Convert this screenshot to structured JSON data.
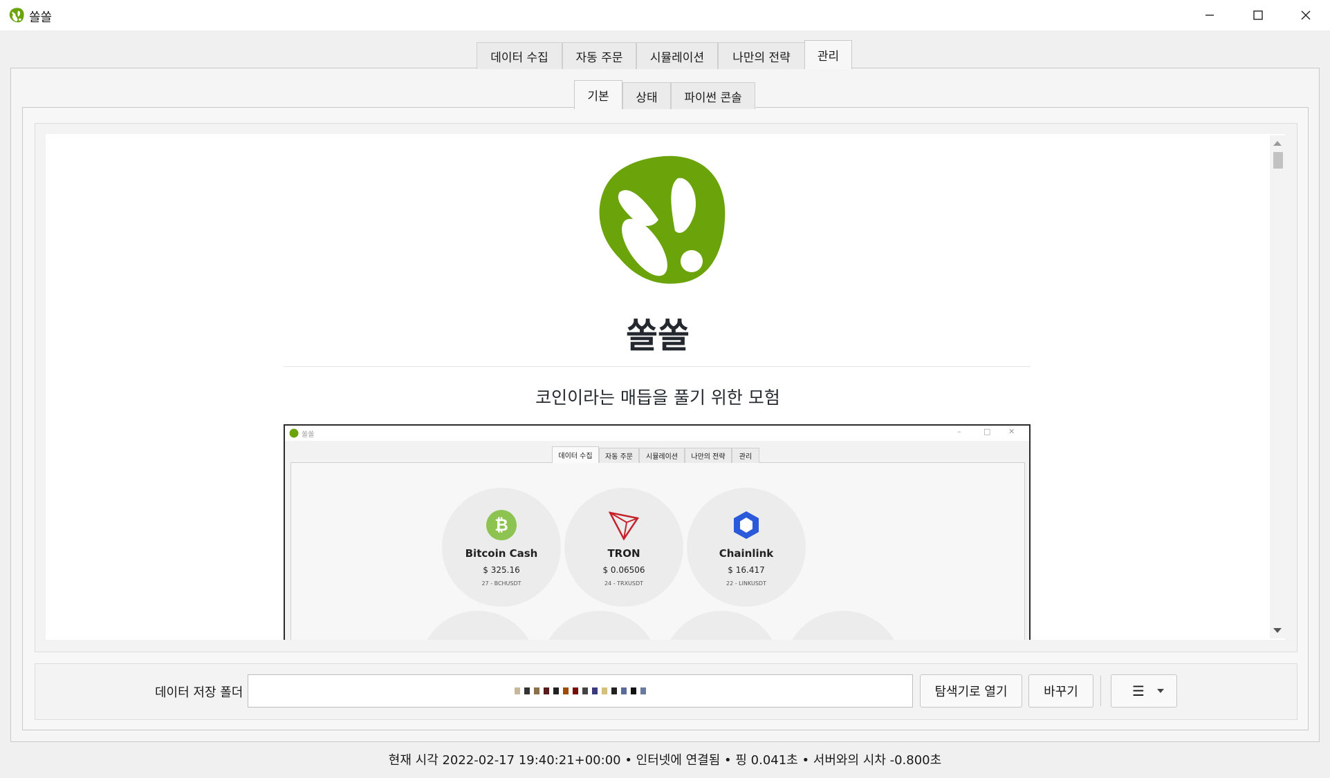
{
  "window": {
    "title": "쏠쏠"
  },
  "top_tabs": [
    {
      "label": "데이터 수집"
    },
    {
      "label": "자동 주문"
    },
    {
      "label": "시뮬레이션"
    },
    {
      "label": "나만의 전략"
    },
    {
      "label": "관리",
      "active": true
    }
  ],
  "sub_tabs": [
    {
      "label": "기본",
      "active": true
    },
    {
      "label": "상태"
    },
    {
      "label": "파이썬 콘솔"
    }
  ],
  "readme": {
    "app_name": "쏠쏠",
    "tagline": "코인이라는 매듭을 풀기 위한 모험"
  },
  "embedded_screenshot": {
    "title": "쏠쏠",
    "tabs": [
      "데이터 수집",
      "자동 주문",
      "시뮬레이션",
      "나만의 전략",
      "관리"
    ],
    "coins": [
      {
        "name": "Bitcoin Cash",
        "price": "$ 325.16",
        "symbol": "27 - BCHUSDT",
        "icon": "bitcoin-cash-icon",
        "color": "#8dc351"
      },
      {
        "name": "TRON",
        "price": "$ 0.06506",
        "symbol": "24 - TRXUSDT",
        "icon": "tron-icon",
        "color": "#c4232b"
      },
      {
        "name": "Chainlink",
        "price": "$ 16.417",
        "symbol": "22 - LINKUSDT",
        "icon": "chainlink-icon",
        "color": "#2a5ada"
      }
    ]
  },
  "folder": {
    "label": "데이터 저장 폴더",
    "open_explorer_label": "탐색기로 열기",
    "change_label": "바꾸기",
    "menu_label": "☰"
  },
  "status": {
    "text": "현재 시각 2022-02-17 19:40:21+00:00  •  인터넷에 연결됨  •  핑 0.041초  •  서버와의 시차 -0.800초"
  },
  "colors": {
    "brand_green": "#6aa30a"
  }
}
